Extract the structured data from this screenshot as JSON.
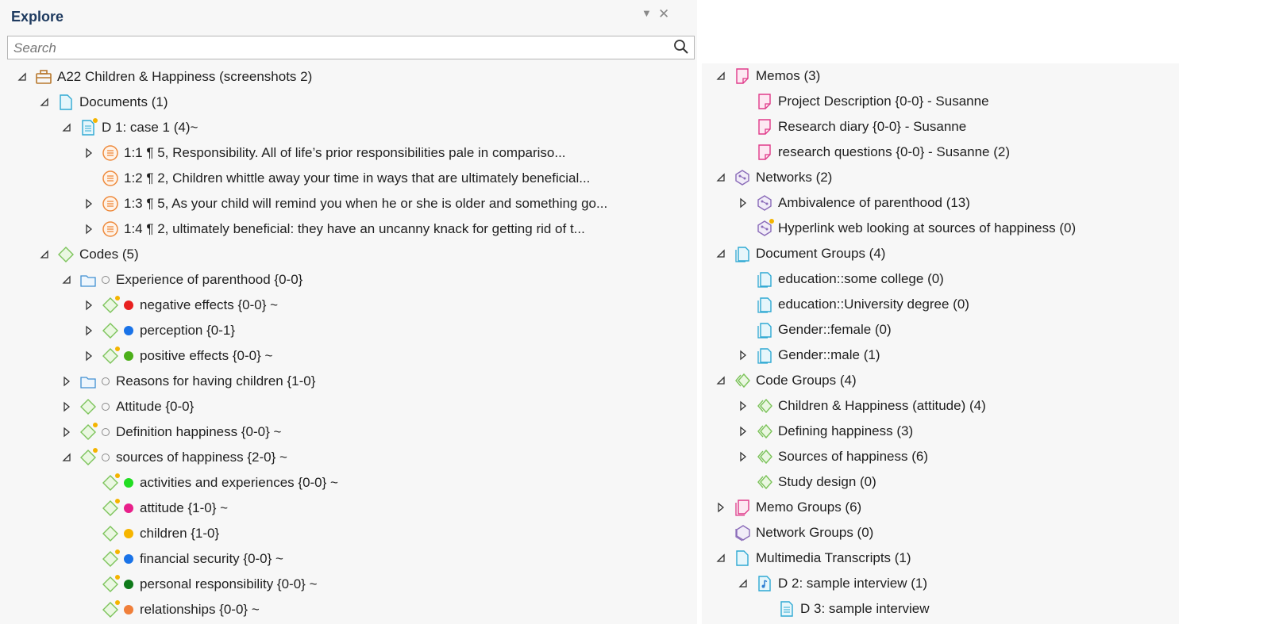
{
  "explore": {
    "title": "Explore",
    "search_placeholder": "Search",
    "tree": [
      {
        "depth": 0,
        "toggle": "expanded",
        "icon": "project-icon",
        "label": "A22 Children & Happiness (screenshots 2)"
      },
      {
        "depth": 1,
        "toggle": "expanded",
        "icon": "documents-icon",
        "label": "Documents (1)"
      },
      {
        "depth": 2,
        "toggle": "expanded",
        "icon": "document-icon",
        "star": true,
        "label": "D 1: case 1 (4)~"
      },
      {
        "depth": 3,
        "toggle": "collapsed",
        "icon": "quotation-icon",
        "label": "1:1 ¶ 5, Responsibility. All of life’s prior responsibilities pale in compariso..."
      },
      {
        "depth": 3,
        "toggle": "none",
        "icon": "quotation-icon",
        "label": "1:2 ¶ 2, Children whittle away your time in ways that are ultimately beneficial..."
      },
      {
        "depth": 3,
        "toggle": "collapsed",
        "icon": "quotation-icon",
        "label": "1:3 ¶ 5, As your child will remind you when he or she is older and something go..."
      },
      {
        "depth": 3,
        "toggle": "collapsed",
        "icon": "quotation-icon",
        "label": "1:4 ¶ 2, ultimately beneficial: they have an uncanny knack for getting rid of t..."
      },
      {
        "depth": 1,
        "toggle": "expanded",
        "icon": "codes-icon",
        "label": "Codes (5)"
      },
      {
        "depth": 2,
        "toggle": "expanded",
        "icon": "folder-icon",
        "marker": "ring",
        "label": "Experience of parenthood {0-0}"
      },
      {
        "depth": 3,
        "toggle": "collapsed",
        "icon": "code-icon",
        "star": true,
        "marker": "dot",
        "color": "#e8201f",
        "label": "negative effects {0-0} ~"
      },
      {
        "depth": 3,
        "toggle": "collapsed",
        "icon": "code-icon",
        "marker": "dot",
        "color": "#1a73e8",
        "label": "perception {0-1}"
      },
      {
        "depth": 3,
        "toggle": "collapsed",
        "icon": "code-icon",
        "star": true,
        "marker": "dot",
        "color": "#4caf1a",
        "label": "positive effects {0-0} ~"
      },
      {
        "depth": 2,
        "toggle": "collapsed",
        "icon": "folder-icon",
        "marker": "ring",
        "label": "Reasons for having children {1-0}"
      },
      {
        "depth": 2,
        "toggle": "collapsed",
        "icon": "code-icon",
        "marker": "ring",
        "label": "Attitude {0-0}"
      },
      {
        "depth": 2,
        "toggle": "collapsed",
        "icon": "code-icon",
        "star": true,
        "marker": "ring",
        "label": "Definition happiness {0-0} ~"
      },
      {
        "depth": 2,
        "toggle": "expanded",
        "icon": "code-icon",
        "star": true,
        "marker": "ring",
        "label": "sources of happiness {2-0} ~"
      },
      {
        "depth": 3,
        "toggle": "none",
        "icon": "code-icon",
        "star": true,
        "marker": "dot",
        "color": "#22dd22",
        "label": "activities and experiences {0-0} ~"
      },
      {
        "depth": 3,
        "toggle": "none",
        "icon": "code-icon",
        "star": true,
        "marker": "dot",
        "color": "#e8208a",
        "label": "attitude {1-0} ~"
      },
      {
        "depth": 3,
        "toggle": "none",
        "icon": "code-icon",
        "marker": "dot",
        "color": "#f6b500",
        "label": "children {1-0}"
      },
      {
        "depth": 3,
        "toggle": "none",
        "icon": "code-icon",
        "star": true,
        "marker": "dot",
        "color": "#1a73e8",
        "label": "financial security {0-0} ~"
      },
      {
        "depth": 3,
        "toggle": "none",
        "icon": "code-icon",
        "star": true,
        "marker": "dot",
        "color": "#0f7a1a",
        "label": "personal responsibility {0-0} ~"
      },
      {
        "depth": 3,
        "toggle": "none",
        "icon": "code-icon",
        "star": true,
        "marker": "dot",
        "color": "#f07f3a",
        "label": "relationships {0-0} ~"
      }
    ]
  },
  "right_tree": [
    {
      "depth": 1,
      "toggle": "expanded",
      "icon": "memo-icon",
      "label": "Memos (3)"
    },
    {
      "depth": 2,
      "toggle": "none",
      "icon": "memo-icon",
      "label": "Project Description {0-0} - Susanne"
    },
    {
      "depth": 2,
      "toggle": "none",
      "icon": "memo-icon",
      "label": "Research diary {0-0} - Susanne"
    },
    {
      "depth": 2,
      "toggle": "none",
      "icon": "memo-icon",
      "label": "research questions {0-0} - Susanne (2)"
    },
    {
      "depth": 1,
      "toggle": "expanded",
      "icon": "network-icon",
      "label": "Networks (2)"
    },
    {
      "depth": 2,
      "toggle": "collapsed",
      "icon": "network-icon",
      "label": "Ambivalence of parenthood (13)"
    },
    {
      "depth": 2,
      "toggle": "none",
      "icon": "network-icon",
      "star": true,
      "label": "Hyperlink web looking at sources of happiness (0)"
    },
    {
      "depth": 1,
      "toggle": "expanded",
      "icon": "document-group-icon",
      "label": "Document Groups (4)"
    },
    {
      "depth": 2,
      "toggle": "none",
      "icon": "document-group-icon",
      "label": "education::some college (0)"
    },
    {
      "depth": 2,
      "toggle": "none",
      "icon": "document-group-icon",
      "label": "education::University degree (0)"
    },
    {
      "depth": 2,
      "toggle": "none",
      "icon": "document-group-icon",
      "label": "Gender::female (0)"
    },
    {
      "depth": 2,
      "toggle": "collapsed",
      "icon": "document-group-icon",
      "label": "Gender::male (1)"
    },
    {
      "depth": 1,
      "toggle": "expanded",
      "icon": "code-group-icon",
      "label": "Code Groups (4)"
    },
    {
      "depth": 2,
      "toggle": "collapsed",
      "icon": "code-group-icon",
      "label": "Children & Happiness (attitude) (4)"
    },
    {
      "depth": 2,
      "toggle": "collapsed",
      "icon": "code-group-icon",
      "label": "Defining happiness (3)"
    },
    {
      "depth": 2,
      "toggle": "collapsed",
      "icon": "code-group-icon",
      "label": "Sources of happiness (6)"
    },
    {
      "depth": 2,
      "toggle": "none",
      "icon": "code-group-icon",
      "label": "Study design (0)"
    },
    {
      "depth": 1,
      "toggle": "collapsed",
      "icon": "memo-group-icon",
      "label": "Memo Groups (6)"
    },
    {
      "depth": 1,
      "toggle": "none",
      "icon": "network-group-icon",
      "label": "Network Groups (0)"
    },
    {
      "depth": 1,
      "toggle": "expanded",
      "icon": "multimedia-icon",
      "label": "Multimedia Transcripts (1)"
    },
    {
      "depth": 2,
      "toggle": "expanded",
      "icon": "audio-document-icon",
      "label": "D 2: sample interview (1)"
    },
    {
      "depth": 3,
      "toggle": "none",
      "icon": "document-icon",
      "label": "D 3: sample interview"
    }
  ]
}
